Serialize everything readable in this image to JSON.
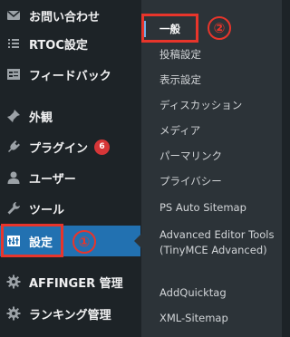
{
  "sidebar": {
    "items": [
      {
        "icon": "mail-icon",
        "label": "お問い合わせ"
      },
      {
        "icon": "list-icon",
        "label": "RTOC設定"
      },
      {
        "icon": "feedback-icon",
        "label": "フィードバック"
      },
      {
        "icon": "pin-icon",
        "label": "外観"
      },
      {
        "icon": "plugin-icon",
        "label": "プラグイン",
        "badge": "6"
      },
      {
        "icon": "user-icon",
        "label": "ユーザー"
      },
      {
        "icon": "wrench-icon",
        "label": "ツール"
      },
      {
        "icon": "settings-icon",
        "label": "設定",
        "active": true
      },
      {
        "icon": "gear-icon",
        "label": "AFFINGER 管理"
      },
      {
        "icon": "gear-icon",
        "label": "ランキング管理"
      }
    ]
  },
  "submenu": {
    "items": [
      "一般",
      "投稿設定",
      "表示設定",
      "ディスカッション",
      "メディア",
      "パーマリンク",
      "プライバシー",
      "PS Auto Sitemap",
      "Advanced Editor Tools (TinyMCE Advanced)",
      "AddQuicktag",
      "XML-Sitemap"
    ],
    "current": "一般"
  },
  "annotations": {
    "step1": "①",
    "step2": "②"
  },
  "colors": {
    "sidebar_bg": "#1d2327",
    "submenu_bg": "#2c3338",
    "active_bg": "#2271b1",
    "highlight": "#e8352b",
    "badge": "#d63638"
  }
}
